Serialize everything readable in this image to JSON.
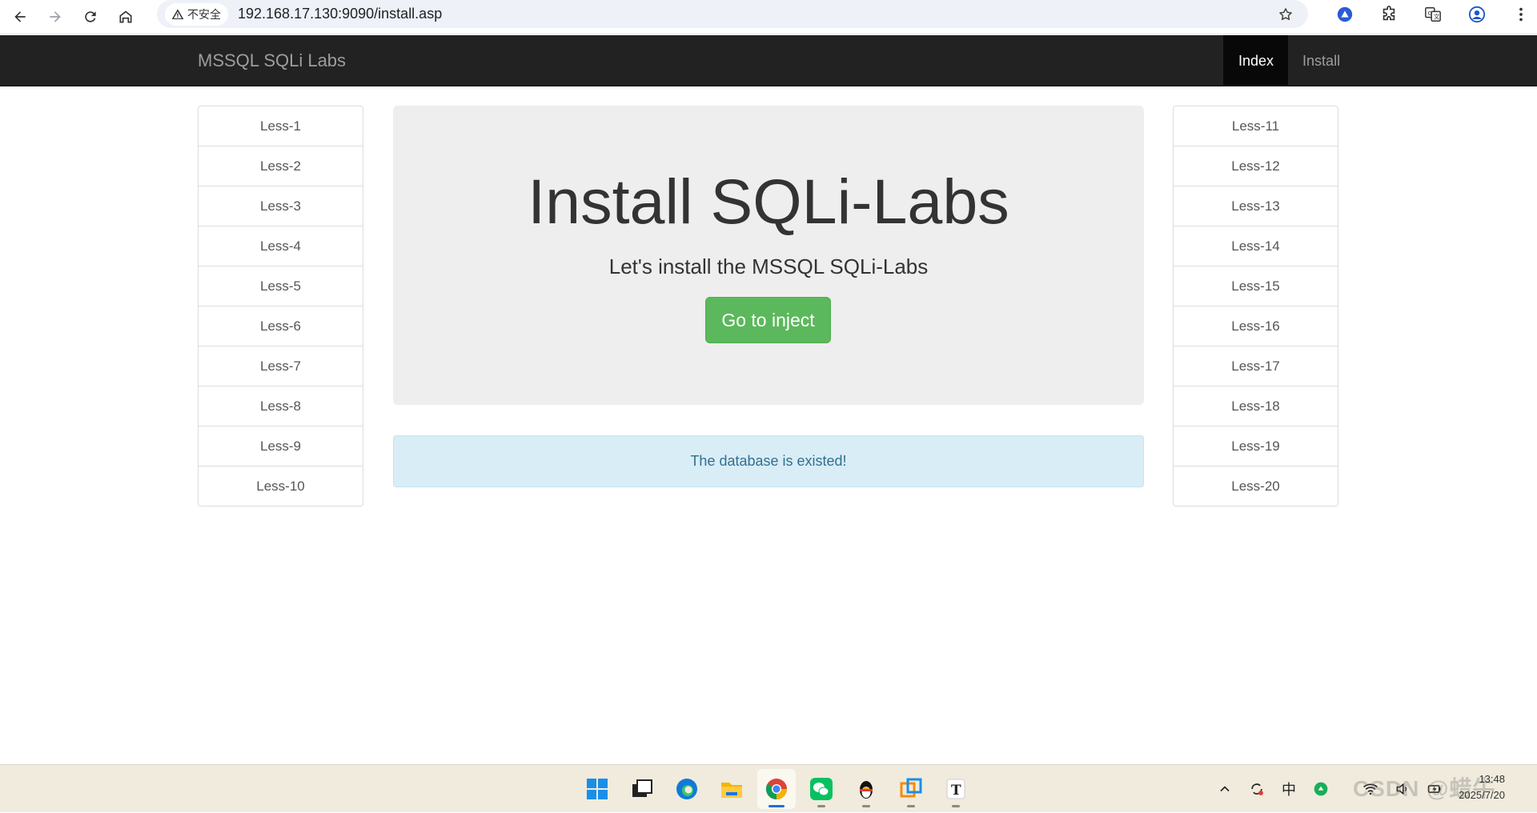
{
  "browser": {
    "security_label": "不安全",
    "url": "192.168.17.130:9090/install.asp"
  },
  "navbar": {
    "brand": "MSSQL SQLi Labs",
    "links": [
      {
        "label": "Index",
        "active": true
      },
      {
        "label": "Install",
        "active": false
      }
    ]
  },
  "left_list": [
    "Less-1",
    "Less-2",
    "Less-3",
    "Less-4",
    "Less-5",
    "Less-6",
    "Less-7",
    "Less-8",
    "Less-9",
    "Less-10"
  ],
  "right_list": [
    "Less-11",
    "Less-12",
    "Less-13",
    "Less-14",
    "Less-15",
    "Less-16",
    "Less-17",
    "Less-18",
    "Less-19",
    "Less-20"
  ],
  "jumbotron": {
    "title": "Install SQLi-Labs",
    "subtitle": "Let's install the MSSQL SQLi-Labs",
    "button": "Go to inject"
  },
  "alert": {
    "message": "The database is existed!"
  },
  "taskbar": {
    "ime": "中",
    "time": "13:48",
    "date": "2025/7/20",
    "watermark": "CSDN @蜡牛"
  },
  "colors": {
    "navbar_bg": "#222222",
    "button_success": "#5cb85c",
    "alert_info_bg": "#d9edf7",
    "alert_info_text": "#31708f"
  }
}
